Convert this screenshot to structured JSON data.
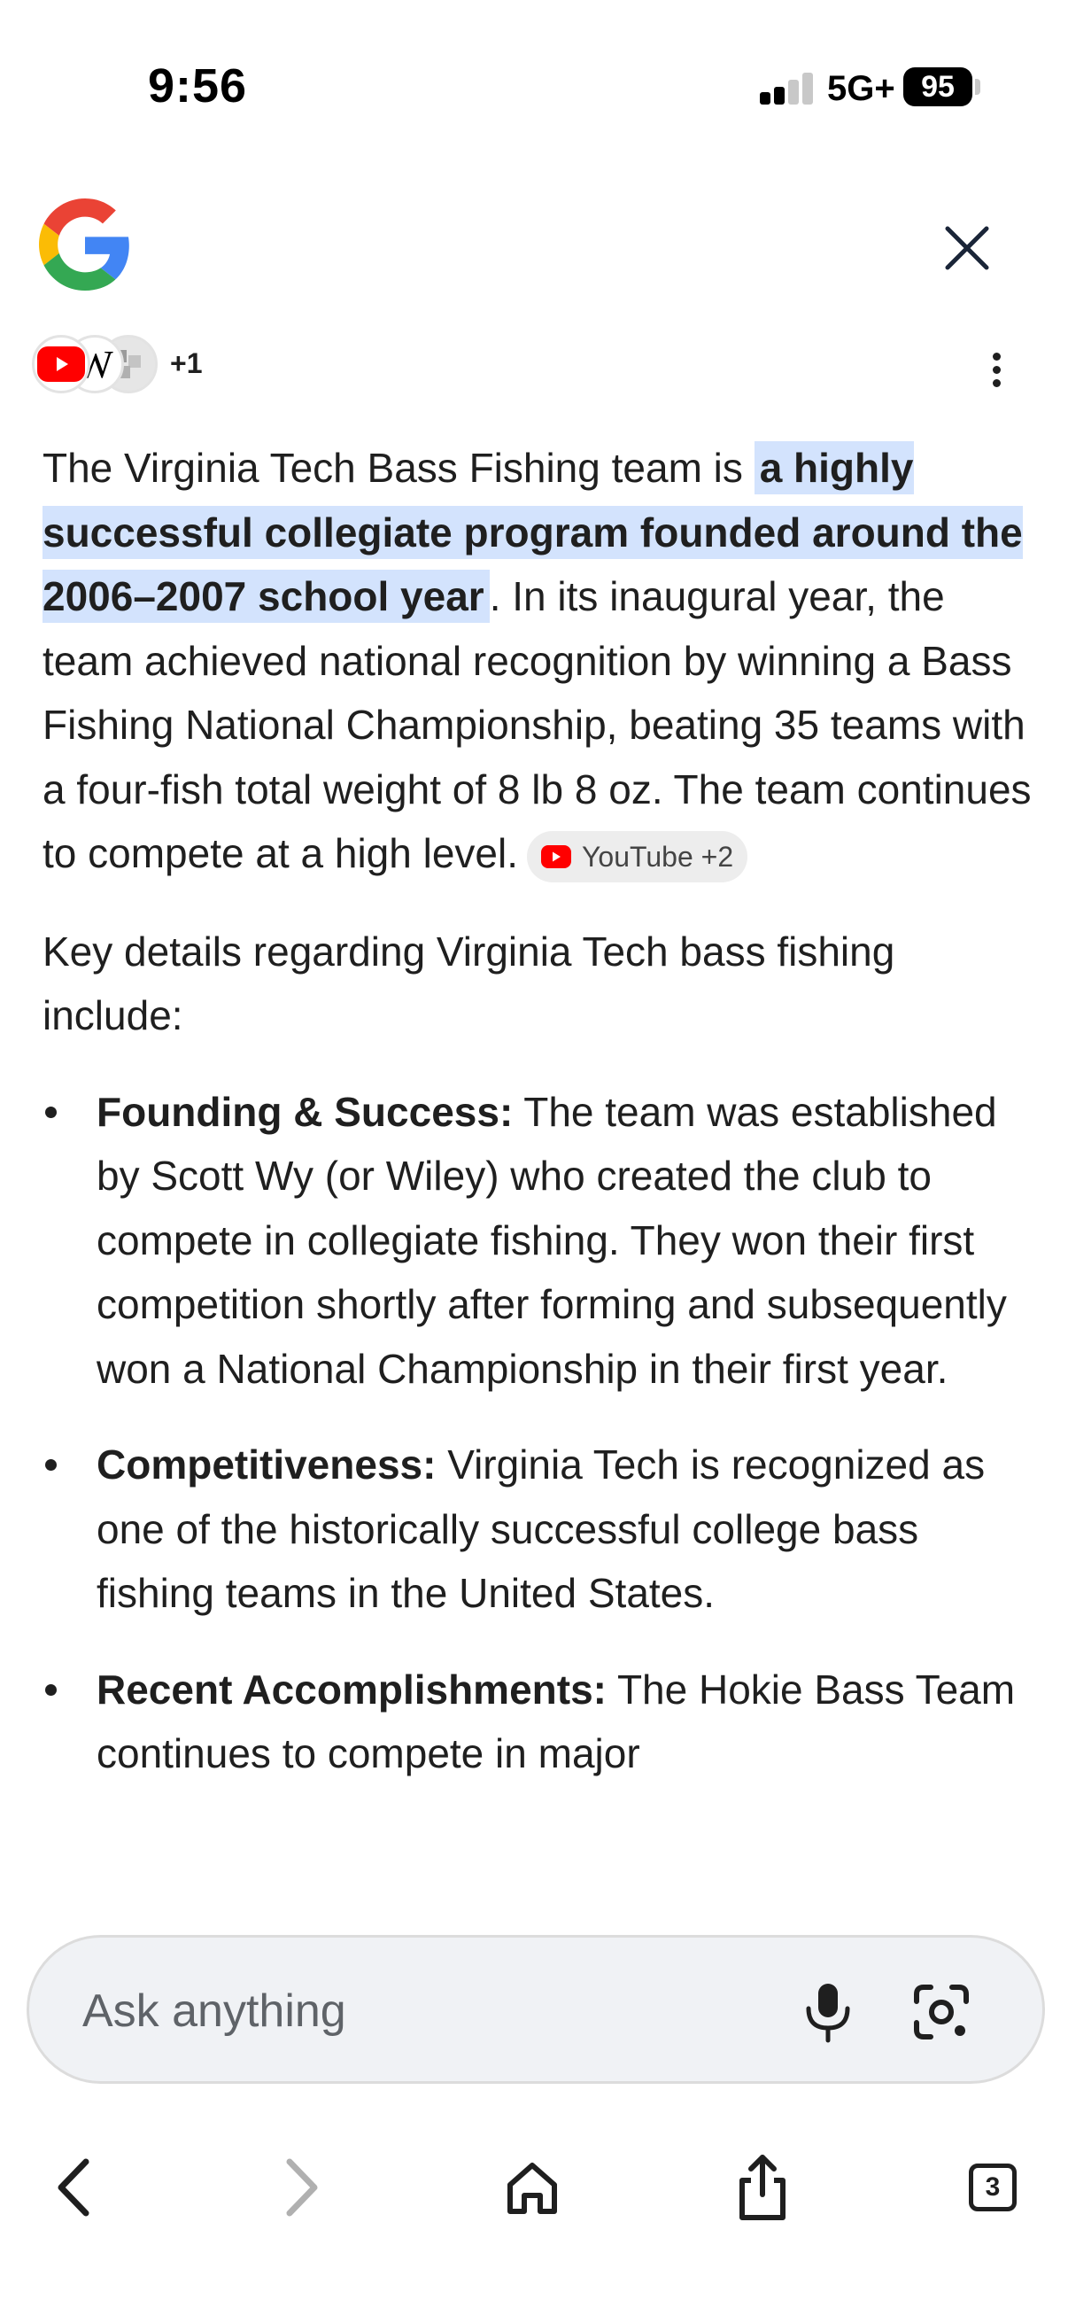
{
  "status_bar": {
    "time": "9:56",
    "network": "5G+",
    "battery": "95"
  },
  "sources": {
    "more_count": "+1",
    "wiki_letter": "W"
  },
  "answer": {
    "intro_before": "The Virginia Tech Bass Fishing team is ",
    "intro_highlight": "a highly successful collegiate program founded around the 2006–2007 school year",
    "intro_after": ". In its inaugural year, the team achieved national recognition by winning a Bass Fishing National Championship, beating 35 teams with a four-fish total weight of 8 lb 8 oz. The team continues to compete at a high level.",
    "citation_label": "YouTube +2",
    "details_intro": "Key details regarding Virginia Tech bass fishing include:",
    "details": [
      {
        "title": "Founding & Success:",
        "text": " The team was established by Scott Wy (or Wiley) who created the club to compete in collegiate fishing. They won their first competition shortly after forming and subsequently won a National Championship in their first year."
      },
      {
        "title": "Competitiveness:",
        "text": " Virginia Tech is recognized as one of the historically successful college bass fishing teams in the United States."
      },
      {
        "title": "Recent Accomplishments:",
        "text": " The Hokie Bass Team continues to compete in major"
      }
    ]
  },
  "ask_bar": {
    "placeholder": "Ask anything"
  },
  "bottom_nav": {
    "tab_count": "3"
  },
  "icons": {
    "logo": "google-g-icon",
    "close": "close-icon",
    "menu": "more-vert-icon",
    "mic": "mic-icon",
    "lens": "google-lens-icon",
    "back": "chevron-left-icon",
    "forward": "chevron-right-icon",
    "home": "home-icon",
    "share": "share-icon"
  },
  "colors": {
    "highlight": "#d3e3fd",
    "youtube_red": "#ff0000",
    "ask_bar_bg": "#f0f2f5",
    "text": "#1f1f1f"
  }
}
